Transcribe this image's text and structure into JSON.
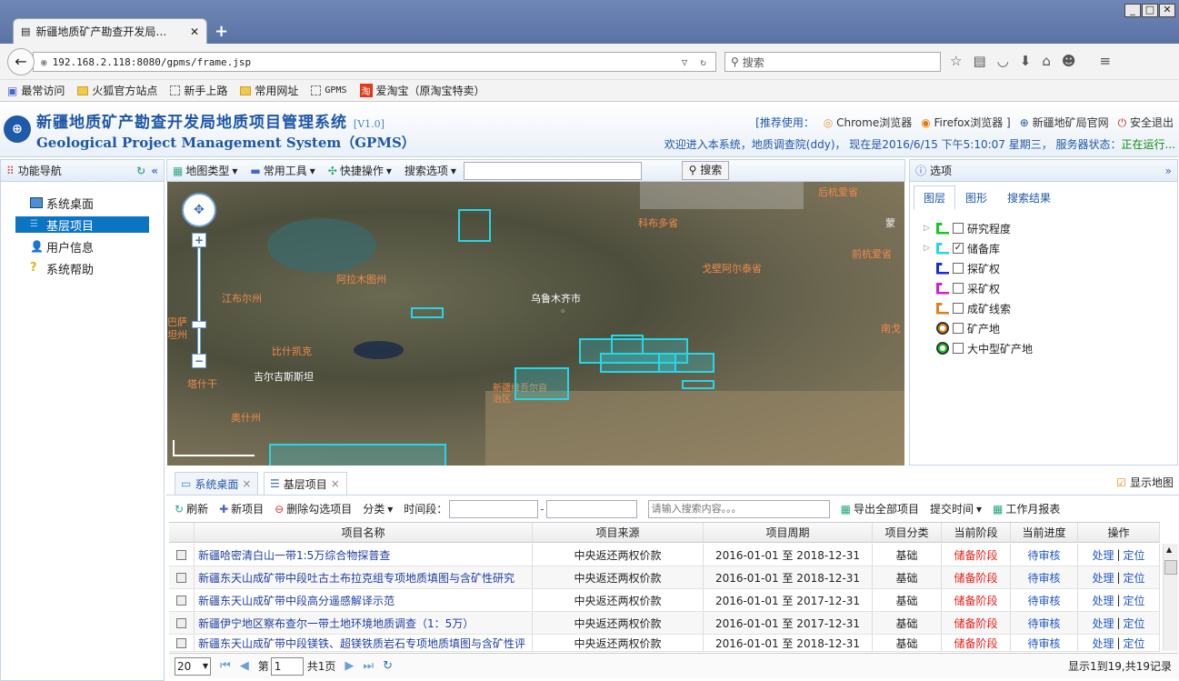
{
  "browser": {
    "tab_title": "新疆地质矿产勘查开发局…",
    "url": "192.168.2.118:8080/gpms/frame.jsp",
    "search_placeholder": "搜索",
    "bookmarks": [
      "最常访问",
      "火狐官方站点",
      "新手上路",
      "常用网址",
      "GPMS",
      "爱淘宝（原淘宝特卖）"
    ]
  },
  "header": {
    "title_cn": "新疆地质矿产勘查开发局地质项目管理系统",
    "version": "[V1.0]",
    "title_en": "Geological Project Management System（GPMS）",
    "recommend": "[推荐使用：",
    "chrome": "Chrome浏览器",
    "firefox": "Firefox浏览器 ]",
    "official": "新疆地矿局官网",
    "logout": "安全退出",
    "welcome": "欢迎进入本系统，地质调查院(ddy)， 现在是2016/6/15 下午5:10:07 星期三， 服务器状态：",
    "status": "正在运行..."
  },
  "nav": {
    "title": "功能导航",
    "items": [
      "系统桌面",
      "基层项目",
      "用户信息",
      "系统帮助"
    ]
  },
  "map_toolbar": {
    "map_type": "地图类型",
    "tools": "常用工具",
    "quick": "快捷操作",
    "search_options": "搜索选项",
    "search_button": "搜索"
  },
  "map_labels": {
    "l1": "乌鲁木齐市",
    "l2": "阿拉木图州",
    "l3": "江布尔州",
    "l4": "吉尔吉斯斯坦",
    "l5": "科布多省",
    "l6": "戈壁阿尔泰省",
    "l7": "后杭爱省",
    "l8": "前杭爱省",
    "l9": "南戈",
    "l10": "蒙",
    "l11": "新疆维吾尔自治区",
    "l12": "奥什州",
    "l13": "比什凯克",
    "l14": "塔什干",
    "l15": "巴萨坦州"
  },
  "right_panel": {
    "title": "选项",
    "tabs": [
      "图层",
      "图形",
      "搜索结果"
    ],
    "layers": [
      {
        "name": "研究程度",
        "checked": false,
        "color": "#19c81e",
        "type": "corner",
        "expand": true
      },
      {
        "name": "储备库",
        "checked": true,
        "color": "#27d6e6",
        "type": "corner",
        "expand": true
      },
      {
        "name": "探矿权",
        "checked": false,
        "color": "#1a2ad6",
        "type": "corner",
        "expand": false
      },
      {
        "name": "采矿权",
        "checked": false,
        "color": "#d61ad6",
        "type": "corner",
        "expand": false
      },
      {
        "name": "成矿线索",
        "checked": false,
        "color": "#e0801a",
        "type": "corner",
        "expand": false
      },
      {
        "name": "矿产地",
        "checked": false,
        "color": "#e0801a",
        "type": "dot",
        "expand": false
      },
      {
        "name": "大中型矿产地",
        "checked": false,
        "color": "#19c81e",
        "type": "dot",
        "expand": false
      }
    ]
  },
  "bottom_tabs": {
    "tab1": "系统桌面",
    "tab2": "基层项目",
    "show_map": "显示地图"
  },
  "grid_toolbar": {
    "refresh": "刷新",
    "new": "新项目",
    "delete": "删除勾选项目",
    "category": "分类",
    "period": "时间段：",
    "search_placeholder": "请输入搜索内容。。。",
    "export": "导出全部项目",
    "submit_time": "提交时间",
    "report": "工作月报表"
  },
  "table": {
    "columns": [
      "项目名称",
      "项目来源",
      "项目周期",
      "项目分类",
      "当前阶段",
      "当前进度",
      "操作"
    ],
    "rows": [
      {
        "name": "新疆哈密清白山一带1:5万综合物探普查",
        "source": "中央返还两权价款",
        "period": "2016-01-01 至 2018-12-31",
        "cat": "基础",
        "stage": "储备阶段",
        "progress": "待审核"
      },
      {
        "name": "新疆东天山成矿带中段吐古土布拉克组专项地质填图与含矿性研究",
        "source": "中央返还两权价款",
        "period": "2016-01-01 至 2018-12-31",
        "cat": "基础",
        "stage": "储备阶段",
        "progress": "待审核"
      },
      {
        "name": "新疆东天山成矿带中段高分遥感解译示范",
        "source": "中央返还两权价款",
        "period": "2016-01-01 至 2017-12-31",
        "cat": "基础",
        "stage": "储备阶段",
        "progress": "待审核"
      },
      {
        "name": "新疆伊宁地区察布查尔一带土地环境地质调查（1：5万）",
        "source": "中央返还两权价款",
        "period": "2016-01-01 至 2017-12-31",
        "cat": "基础",
        "stage": "储备阶段",
        "progress": "待审核"
      },
      {
        "name": "新疆东天山成矿带中段镁铁、超镁铁质岩石专项地质填图与含矿性评",
        "source": "中央返还两权价款",
        "period": "2016-01-01 至 2018-12-31",
        "cat": "基础",
        "stage": "储备阶段",
        "progress": "待审核"
      }
    ],
    "action_process": "处理",
    "action_locate": "定位"
  },
  "pager": {
    "page_size": "20",
    "page_prefix": "第",
    "page": "1",
    "page_total": "共1页",
    "info": "显示1到19,共19记录"
  }
}
